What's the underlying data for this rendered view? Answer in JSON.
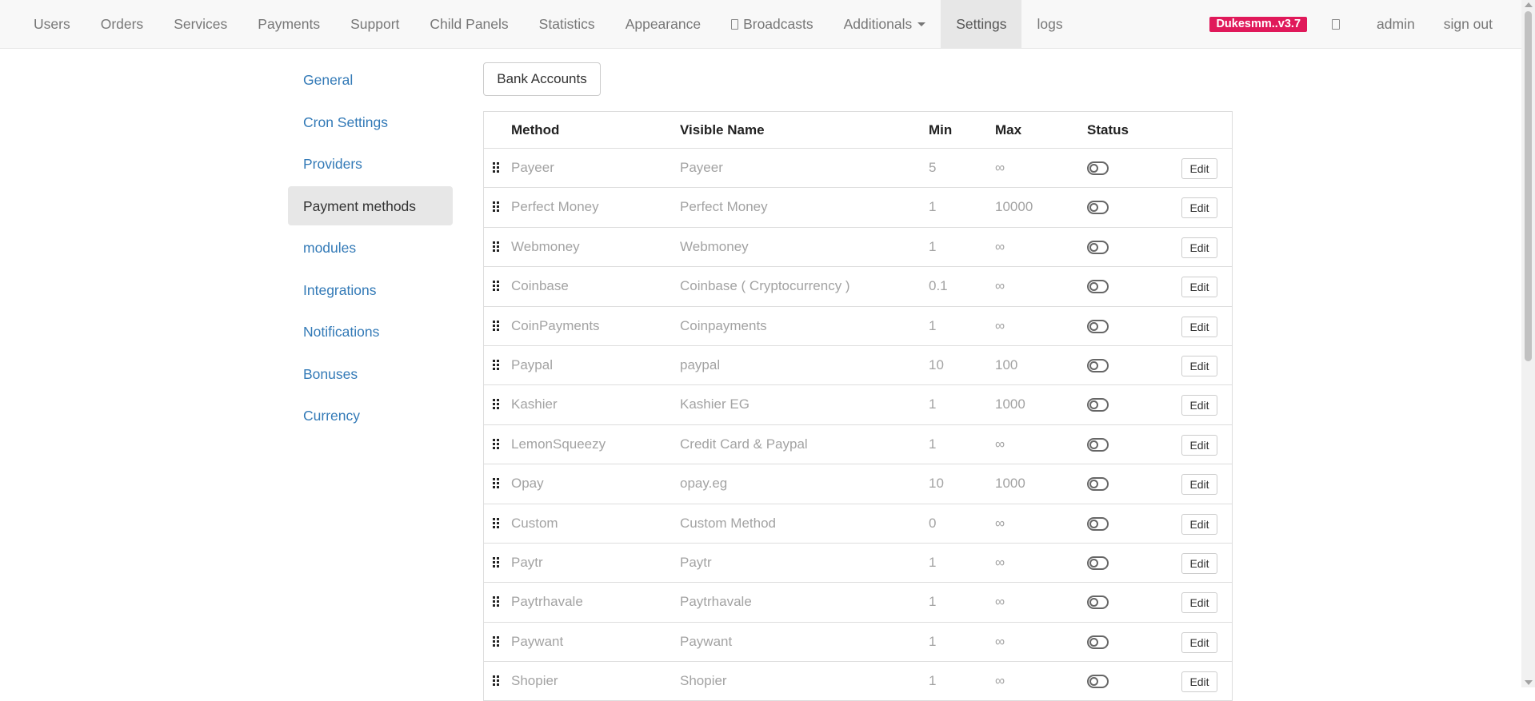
{
  "nav": {
    "items": [
      {
        "label": "Users"
      },
      {
        "label": "Orders"
      },
      {
        "label": "Services"
      },
      {
        "label": "Payments"
      },
      {
        "label": "Support"
      },
      {
        "label": "Child Panels"
      },
      {
        "label": "Statistics"
      },
      {
        "label": "Appearance"
      },
      {
        "label": "Broadcasts"
      },
      {
        "label": "Additionals"
      },
      {
        "label": "Settings"
      },
      {
        "label": "logs"
      }
    ],
    "active": "Settings",
    "brand_badge": "Dukesmm..v3.7",
    "brand_color": "#e0195a",
    "user_label": "admin",
    "signout_label": "sign out",
    "icons": {
      "broadcasts": "broadcast-icon",
      "dropdown": "caret-down-icon",
      "notifications": "square-icon"
    }
  },
  "sidebar": {
    "items": [
      {
        "label": "General"
      },
      {
        "label": "Cron Settings"
      },
      {
        "label": "Providers"
      },
      {
        "label": "Payment methods"
      },
      {
        "label": "modules"
      },
      {
        "label": "Integrations"
      },
      {
        "label": "Notifications"
      },
      {
        "label": "Bonuses"
      },
      {
        "label": "Currency"
      }
    ],
    "active": "Payment methods",
    "link_color": "#337ab7"
  },
  "main": {
    "bank_accounts_label": "Bank Accounts",
    "table": {
      "headers": {
        "method": "Method",
        "visible_name": "Visible Name",
        "min": "Min",
        "max": "Max",
        "status": "Status"
      },
      "edit_label": "Edit",
      "rows": [
        {
          "method": "Payeer",
          "visible_name": "Payeer",
          "min": "5",
          "max": "∞",
          "enabled": false
        },
        {
          "method": "Perfect Money",
          "visible_name": "Perfect Money",
          "min": "1",
          "max": "10000",
          "enabled": false
        },
        {
          "method": "Webmoney",
          "visible_name": "Webmoney",
          "min": "1",
          "max": "∞",
          "enabled": false
        },
        {
          "method": "Coinbase",
          "visible_name": "Coinbase ( Cryptocurrency )",
          "min": "0.1",
          "max": "∞",
          "enabled": false
        },
        {
          "method": "CoinPayments",
          "visible_name": "Coinpayments",
          "min": "1",
          "max": "∞",
          "enabled": false
        },
        {
          "method": "Paypal",
          "visible_name": "paypal",
          "min": "10",
          "max": "100",
          "enabled": false
        },
        {
          "method": "Kashier",
          "visible_name": "Kashier EG",
          "min": "1",
          "max": "1000",
          "enabled": false
        },
        {
          "method": "LemonSqueezy",
          "visible_name": "Credit Card & Paypal",
          "min": "1",
          "max": "∞",
          "enabled": false
        },
        {
          "method": "Opay",
          "visible_name": "opay.eg",
          "min": "10",
          "max": "1000",
          "enabled": false
        },
        {
          "method": "Custom",
          "visible_name": "Custom Method",
          "min": "0",
          "max": "∞",
          "enabled": false
        },
        {
          "method": "Paytr",
          "visible_name": "Paytr",
          "min": "1",
          "max": "∞",
          "enabled": false
        },
        {
          "method": "Paytrhavale",
          "visible_name": "Paytrhavale",
          "min": "1",
          "max": "∞",
          "enabled": false
        },
        {
          "method": "Paywant",
          "visible_name": "Paywant",
          "min": "1",
          "max": "∞",
          "enabled": false
        },
        {
          "method": "Shopier",
          "visible_name": "Shopier",
          "min": "1",
          "max": "∞",
          "enabled": false
        }
      ]
    }
  }
}
